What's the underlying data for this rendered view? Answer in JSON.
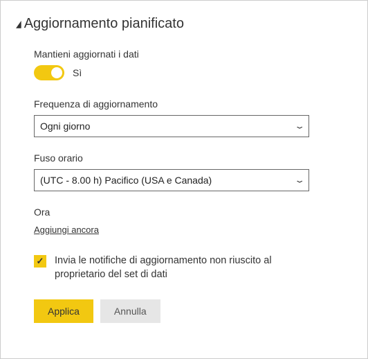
{
  "header": {
    "title": "Aggiornamento pianificato"
  },
  "keepDataUpdated": {
    "label": "Mantieni aggiornati i dati",
    "stateText": "Sì",
    "on": true
  },
  "refreshFrequency": {
    "label": "Frequenza di aggiornamento",
    "value": "Ogni giorno"
  },
  "timeZone": {
    "label": "Fuso orario",
    "value": "(UTC - 8.00 h) Pacifico (USA e Canada)"
  },
  "time": {
    "label": "Ora",
    "addMoreLink": "Aggiungi ancora"
  },
  "notification": {
    "checked": true,
    "label": "Invia le notifiche di aggiornamento non riuscito al proprietario del set di dati"
  },
  "buttons": {
    "apply": "Applica",
    "cancel": "Annulla"
  }
}
